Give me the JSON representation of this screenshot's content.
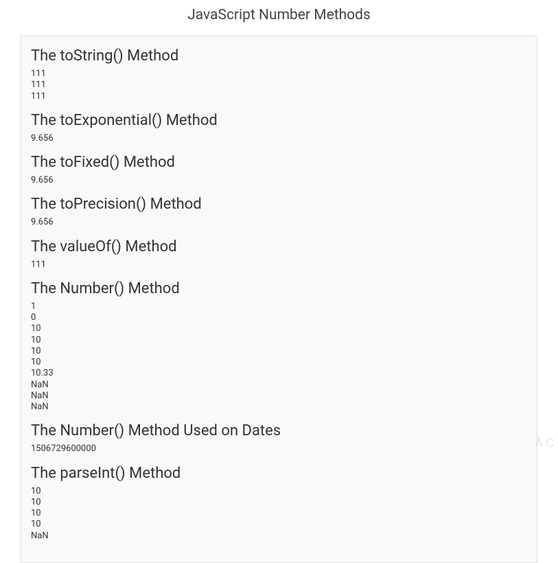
{
  "title": "JavaScript Number Methods",
  "sections": {
    "tostring": {
      "heading": "The toString() Method",
      "output": "111\n111\n111"
    },
    "toexponential": {
      "heading": "The toExponential() Method",
      "output": "9.656"
    },
    "tofixed": {
      "heading": "The toFixed() Method",
      "output": "9.656"
    },
    "toprecision": {
      "heading": "The toPrecision() Method",
      "output": "9.656"
    },
    "valueof": {
      "heading": "The valueOf() Method",
      "output": "111"
    },
    "number": {
      "heading": "The Number() Method",
      "output": "1\n0\n10\n10\n10\n10\n10.33\nNaN\nNaN\nNaN"
    },
    "numberdates": {
      "heading": "The Number() Method Used on Dates",
      "output": "1506729600000"
    },
    "parseint": {
      "heading": "The parseInt() Method",
      "output": "10\n10\n10\n10\nNaN"
    }
  },
  "faint": "A\nC"
}
